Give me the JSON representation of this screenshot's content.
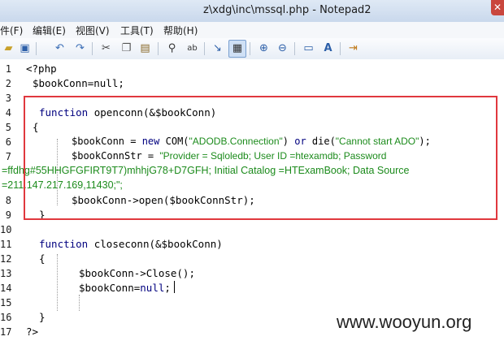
{
  "window": {
    "title": "z\\xdg\\inc\\mssql.php - Notepad2",
    "close_glyph": "✕"
  },
  "menu": [
    "件(F)",
    "编辑(E)",
    "视图(V)",
    "工具(T)",
    "帮助(H)"
  ],
  "toolbar_icons": [
    "open-icon",
    "save-icon",
    "undo-icon",
    "redo-icon",
    "cut-icon",
    "copy-icon",
    "paste-icon",
    "find-icon",
    "replace-icon",
    "wordwrap-icon",
    "view-icon",
    "zoom-in-icon",
    "zoom-out-icon",
    "settings-icon",
    "font-icon",
    "exit-icon"
  ],
  "lines": {
    "1": "<?php",
    "2": "$bookConn=null;",
    "4_kw": "function",
    "4_rest": " openconn(&$bookConn)",
    "5": "{",
    "6_a": "$bookConn = ",
    "6_kw1": "new",
    "6_b": " COM(",
    "6_str1": "\"ADODB.Connection\"",
    "6_c": ") ",
    "6_kw2": "or",
    "6_d": " die(",
    "6_str2": "\"Cannot start ADO\"",
    "6_e": ");",
    "7_a": "$bookConnStr = ",
    "7_str": "\"Provider = Sqloledb; User ID =htexamdb; Password",
    "7_wrap1": "=ffdhg#55HHGFGFIRT9T7)mhhjG78+D7GFH; Initial Catalog =HTExamBook; Data Source",
    "7_wrap2": "=211.147.217.169,11430;\";",
    "8": "$bookConn->open($bookConnStr);",
    "9": "}",
    "11_kw": "function",
    "11_rest": " closeconn(&$bookConn)",
    "12": "{",
    "13": "$bookConn->Close();",
    "14_a": "$bookConn=",
    "14_kw": "null",
    "14_b": ";",
    "16": "}",
    "17": "?>"
  },
  "line_numbers": [
    "1",
    "2",
    "3",
    "4",
    "5",
    "6",
    "7",
    "8",
    "9",
    "10",
    "11",
    "12",
    "13",
    "14",
    "15",
    "16",
    "17"
  ],
  "watermark": "www.wooyun.org",
  "colors": {
    "highlight_box": "#e0383e",
    "keyword": "#00007f",
    "string": "#1c8b1c"
  }
}
